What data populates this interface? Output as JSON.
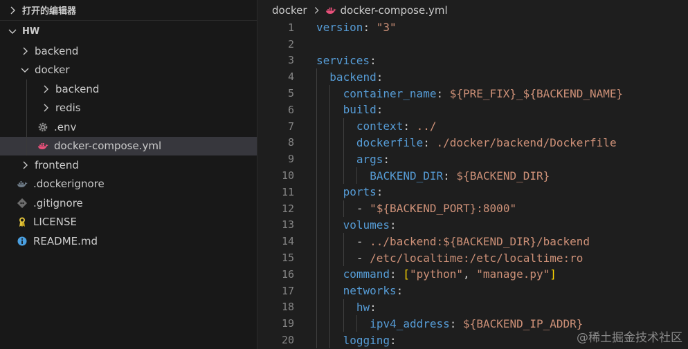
{
  "sidebar": {
    "open_editors_label": "打开的编辑器",
    "workspace_label": "HW",
    "items": [
      {
        "label": "backend",
        "kind": "folder",
        "depth": 1,
        "expanded": false
      },
      {
        "label": "docker",
        "kind": "folder",
        "depth": 1,
        "expanded": true
      },
      {
        "label": "backend",
        "kind": "folder",
        "depth": 2,
        "expanded": false
      },
      {
        "label": "redis",
        "kind": "folder",
        "depth": 2,
        "expanded": false
      },
      {
        "label": ".env",
        "kind": "file",
        "icon": "gear-icon",
        "depth": 2
      },
      {
        "label": "docker-compose.yml",
        "kind": "file",
        "icon": "docker-whale-icon",
        "depth": 2,
        "selected": true
      },
      {
        "label": "frontend",
        "kind": "folder",
        "depth": 1,
        "expanded": false
      },
      {
        "label": ".dockerignore",
        "kind": "file",
        "icon": "docker-grey-icon",
        "depth": 1
      },
      {
        "label": ".gitignore",
        "kind": "file",
        "icon": "git-icon",
        "depth": 1
      },
      {
        "label": "LICENSE",
        "kind": "file",
        "icon": "license-icon",
        "depth": 1
      },
      {
        "label": "README.md",
        "kind": "file",
        "icon": "info-icon",
        "depth": 1
      }
    ]
  },
  "breadcrumb": {
    "folder": "docker",
    "file": "docker-compose.yml"
  },
  "code": {
    "lines": [
      {
        "n": "1",
        "indent": 0,
        "tokens": [
          [
            "key",
            "version"
          ],
          [
            "punc",
            ": "
          ],
          [
            "str",
            "\"3\""
          ]
        ]
      },
      {
        "n": "2",
        "indent": 0,
        "tokens": []
      },
      {
        "n": "3",
        "indent": 0,
        "tokens": [
          [
            "key",
            "services"
          ],
          [
            "punc",
            ":"
          ]
        ]
      },
      {
        "n": "4",
        "indent": 1,
        "tokens": [
          [
            "key",
            "backend"
          ],
          [
            "punc",
            ":"
          ]
        ]
      },
      {
        "n": "5",
        "indent": 2,
        "tokens": [
          [
            "key",
            "container_name"
          ],
          [
            "punc",
            ": "
          ],
          [
            "str",
            "${PRE_FIX}_${BACKEND_NAME}"
          ]
        ]
      },
      {
        "n": "6",
        "indent": 2,
        "tokens": [
          [
            "key",
            "build"
          ],
          [
            "punc",
            ":"
          ]
        ]
      },
      {
        "n": "7",
        "indent": 3,
        "tokens": [
          [
            "key",
            "context"
          ],
          [
            "punc",
            ": "
          ],
          [
            "str",
            "../"
          ]
        ]
      },
      {
        "n": "8",
        "indent": 3,
        "tokens": [
          [
            "key",
            "dockerfile"
          ],
          [
            "punc",
            ": "
          ],
          [
            "str",
            "./docker/backend/Dockerfile"
          ]
        ]
      },
      {
        "n": "9",
        "indent": 3,
        "tokens": [
          [
            "key",
            "args"
          ],
          [
            "punc",
            ":"
          ]
        ]
      },
      {
        "n": "10",
        "indent": 4,
        "tokens": [
          [
            "key",
            "BACKEND_DIR"
          ],
          [
            "punc",
            ": "
          ],
          [
            "str",
            "${BACKEND_DIR}"
          ]
        ]
      },
      {
        "n": "11",
        "indent": 2,
        "tokens": [
          [
            "key",
            "ports"
          ],
          [
            "punc",
            ":"
          ]
        ]
      },
      {
        "n": "12",
        "indent": 3,
        "tokens": [
          [
            "punc",
            "- "
          ],
          [
            "str",
            "\"${BACKEND_PORT}:8000\""
          ]
        ]
      },
      {
        "n": "13",
        "indent": 2,
        "tokens": [
          [
            "key",
            "volumes"
          ],
          [
            "punc",
            ":"
          ]
        ]
      },
      {
        "n": "14",
        "indent": 3,
        "tokens": [
          [
            "punc",
            "- "
          ],
          [
            "str",
            "../backend:${BACKEND_DIR}/backend"
          ]
        ]
      },
      {
        "n": "15",
        "indent": 3,
        "tokens": [
          [
            "punc",
            "- "
          ],
          [
            "str",
            "/etc/localtime:/etc/localtime:ro"
          ]
        ]
      },
      {
        "n": "16",
        "indent": 2,
        "tokens": [
          [
            "key",
            "command"
          ],
          [
            "punc",
            ": "
          ],
          [
            "brk",
            "["
          ],
          [
            "str",
            "\"python\""
          ],
          [
            "punc",
            ", "
          ],
          [
            "str",
            "\"manage.py\""
          ],
          [
            "brk",
            "]"
          ]
        ]
      },
      {
        "n": "17",
        "indent": 2,
        "tokens": [
          [
            "key",
            "networks"
          ],
          [
            "punc",
            ":"
          ]
        ]
      },
      {
        "n": "18",
        "indent": 3,
        "tokens": [
          [
            "key",
            "hw"
          ],
          [
            "punc",
            ":"
          ]
        ]
      },
      {
        "n": "19",
        "indent": 4,
        "tokens": [
          [
            "key",
            "ipv4_address"
          ],
          [
            "punc",
            ": "
          ],
          [
            "str",
            "${BACKEND_IP_ADDR}"
          ]
        ]
      },
      {
        "n": "20",
        "indent": 2,
        "tokens": [
          [
            "key",
            "logging"
          ],
          [
            "punc",
            ":"
          ]
        ]
      }
    ]
  },
  "watermark": "@稀土掘金技术社区",
  "colors": {
    "key": "#569cd6",
    "string": "#ce9178",
    "bracket": "#ffd700",
    "selection": "#37373d",
    "docker": "#e8507a"
  }
}
